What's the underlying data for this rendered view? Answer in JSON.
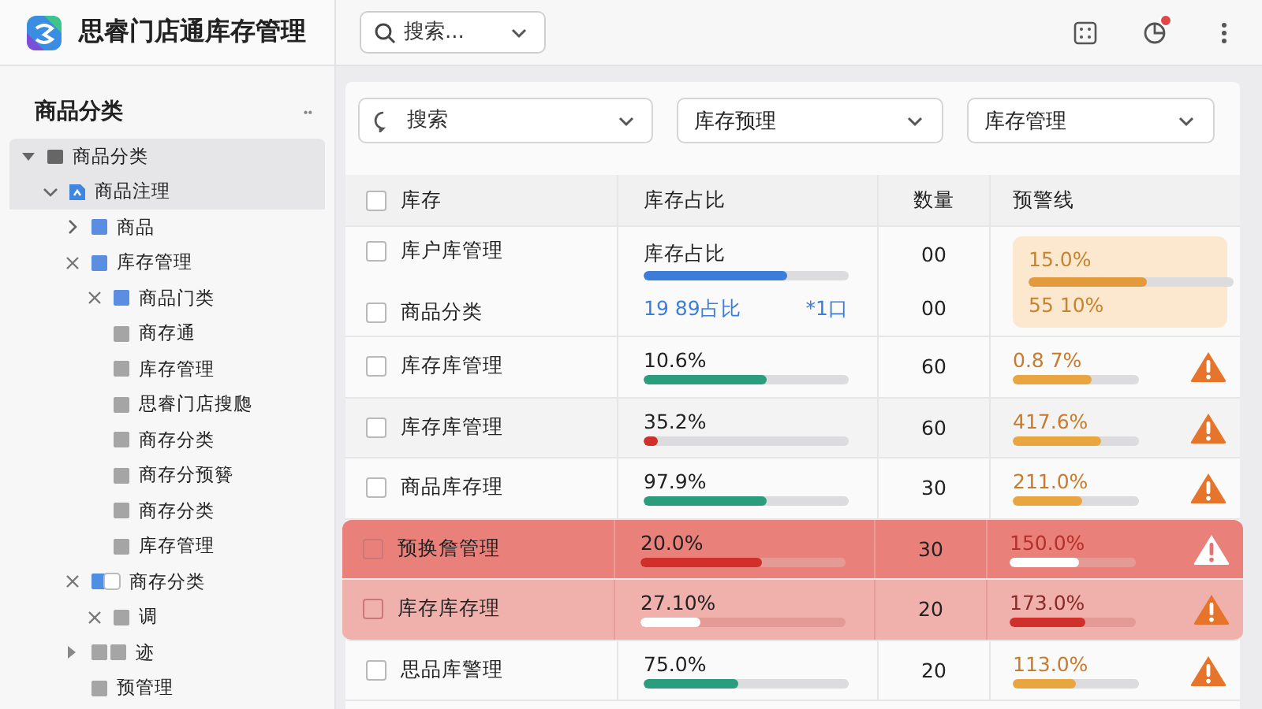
{
  "app": {
    "title": "思睿门店通库存管理"
  },
  "sidebar": {
    "title": "商品分类",
    "more": "••",
    "tree": [
      {
        "label": "商品分类",
        "kind": "root",
        "selected": true,
        "children": [
          {
            "label": "商品注理",
            "kind": "group",
            "selected": true,
            "children": [
              {
                "label": "商品",
                "kind": "branch",
                "selected": false
              },
              {
                "label": "库存管理",
                "kind": "open",
                "selected": false,
                "children": [
                  {
                    "label": "商品门类",
                    "kind": "open",
                    "selected": false
                  },
                  {
                    "label": "商存通",
                    "kind": "leaf",
                    "selected": false
                  },
                  {
                    "label": "库存管理",
                    "kind": "leaf",
                    "selected": false
                  },
                  {
                    "label": "思睿门店搜瓟",
                    "kind": "leaf",
                    "selected": false
                  },
                  {
                    "label": "商存分类",
                    "kind": "leaf",
                    "selected": false
                  },
                  {
                    "label": "商存分预籫",
                    "kind": "leaf",
                    "selected": false
                  },
                  {
                    "label": "商存分类",
                    "kind": "leaf",
                    "selected": false
                  },
                  {
                    "label": "库存管理",
                    "kind": "leaf",
                    "selected": false
                  }
                ]
              },
              {
                "label": "商存分类",
                "kind": "pair",
                "selected": false,
                "children": [
                  {
                    "label": "调",
                    "kind": "sub",
                    "selected": false
                  }
                ]
              },
              {
                "label": "迹",
                "kind": "stack",
                "selected": false
              },
              {
                "label": "预管理",
                "kind": "leaf",
                "selected": false
              }
            ]
          }
        ]
      }
    ]
  },
  "topbar": {
    "search": {
      "placeholder": "搜索..."
    },
    "notification_badge": true
  },
  "filters": [
    {
      "kind": "search",
      "placeholder": "搜索"
    },
    {
      "kind": "select",
      "value": "库存预理"
    },
    {
      "kind": "select",
      "value": "库存管理"
    }
  ],
  "table": {
    "columns": [
      "库存",
      "库存占比",
      "数量",
      "预警线"
    ],
    "all_checked": false,
    "rows": [
      {
        "kind": "summary",
        "lines": [
          {
            "name": "库户库管理",
            "checked": false,
            "quantity": "00"
          },
          {
            "name": "商品分类",
            "checked": false,
            "quantity": "00"
          }
        ],
        "share": {
          "label": "库存占比",
          "level": 0.7,
          "color": "#3b7dd8",
          "note": "19 89占比",
          "extra": "*1口"
        },
        "warning": {
          "value": "15.0%",
          "level": 0.58,
          "color": "#e39a3b",
          "value2": "55 10%"
        }
      },
      {
        "kind": "normal",
        "name": "库存库管理",
        "checked": false,
        "share": {
          "value": "10.6%",
          "level": 0.6,
          "color": "#2a9d7f"
        },
        "quantity": "60",
        "warning": {
          "value": "0.8 7%",
          "level": 0.62,
          "color": "#e9a640"
        },
        "alert": true
      },
      {
        "kind": "striped",
        "name": "库存库管理",
        "checked": false,
        "share": {
          "value": "35.2%",
          "level": 0.07,
          "color": "#d0302a"
        },
        "quantity": "60",
        "warning": {
          "value": "417.6%",
          "level": 0.7,
          "color": "#e9a640"
        },
        "alert": true
      },
      {
        "kind": "normal",
        "name": "商品库存理",
        "checked": false,
        "share": {
          "value": "97.9%",
          "level": 0.6,
          "color": "#2a9d7f"
        },
        "quantity": "30",
        "warning": {
          "value": "211.0%",
          "level": 0.55,
          "color": "#e9a640"
        },
        "alert": true
      },
      {
        "kind": "danger",
        "name": "预换詹管理",
        "checked": false,
        "share": {
          "value": "20.0%",
          "level": 0.59,
          "color": "#d0302a"
        },
        "quantity": "30",
        "warning": {
          "value": "150.0%",
          "level": 0.55,
          "color": "#ffffff"
        },
        "alert": true
      },
      {
        "kind": "caution",
        "name": "库存库存理",
        "checked": false,
        "share": {
          "value": "27.10%",
          "level": 0.29,
          "color": "#ffffff"
        },
        "quantity": "20",
        "warning": {
          "value": "173.0%",
          "level": 0.6,
          "color": "#d0302a"
        },
        "alert": true
      },
      {
        "kind": "normal",
        "name": "思品库警理",
        "checked": false,
        "share": {
          "value": "75.0%",
          "level": 0.46,
          "color": "#2a9d7f"
        },
        "quantity": "20",
        "warning": {
          "value": "113.0%",
          "level": 0.5,
          "color": "#e9a640"
        },
        "alert": true
      }
    ]
  }
}
